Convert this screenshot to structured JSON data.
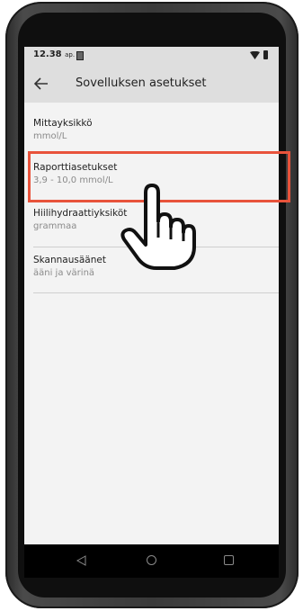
{
  "status_bar": {
    "time": "12.38",
    "time_suffix": "ap.",
    "icons": [
      "document-icon",
      "wifi-icon",
      "battery-icon"
    ]
  },
  "app_bar": {
    "back_icon": "arrow-left-icon",
    "title": "Sovelluksen asetukset"
  },
  "settings": [
    {
      "label": "Mittayksikkö",
      "value": "mmol/L"
    },
    {
      "label": "Raporttiasetukset",
      "value": "3,9 - 10,0 mmol/L",
      "highlighted": true
    },
    {
      "label": "Hiilihydraattiyksiköt",
      "value": "grammaa"
    },
    {
      "label": "Skannausäänet",
      "value": "ääni ja värinä"
    }
  ],
  "overlay": {
    "icon": "pointing-hand-icon",
    "highlight_color": "#e8533b"
  },
  "nav_bar": {
    "icons": [
      "nav-back-icon",
      "nav-home-icon",
      "nav-recents-icon"
    ]
  }
}
